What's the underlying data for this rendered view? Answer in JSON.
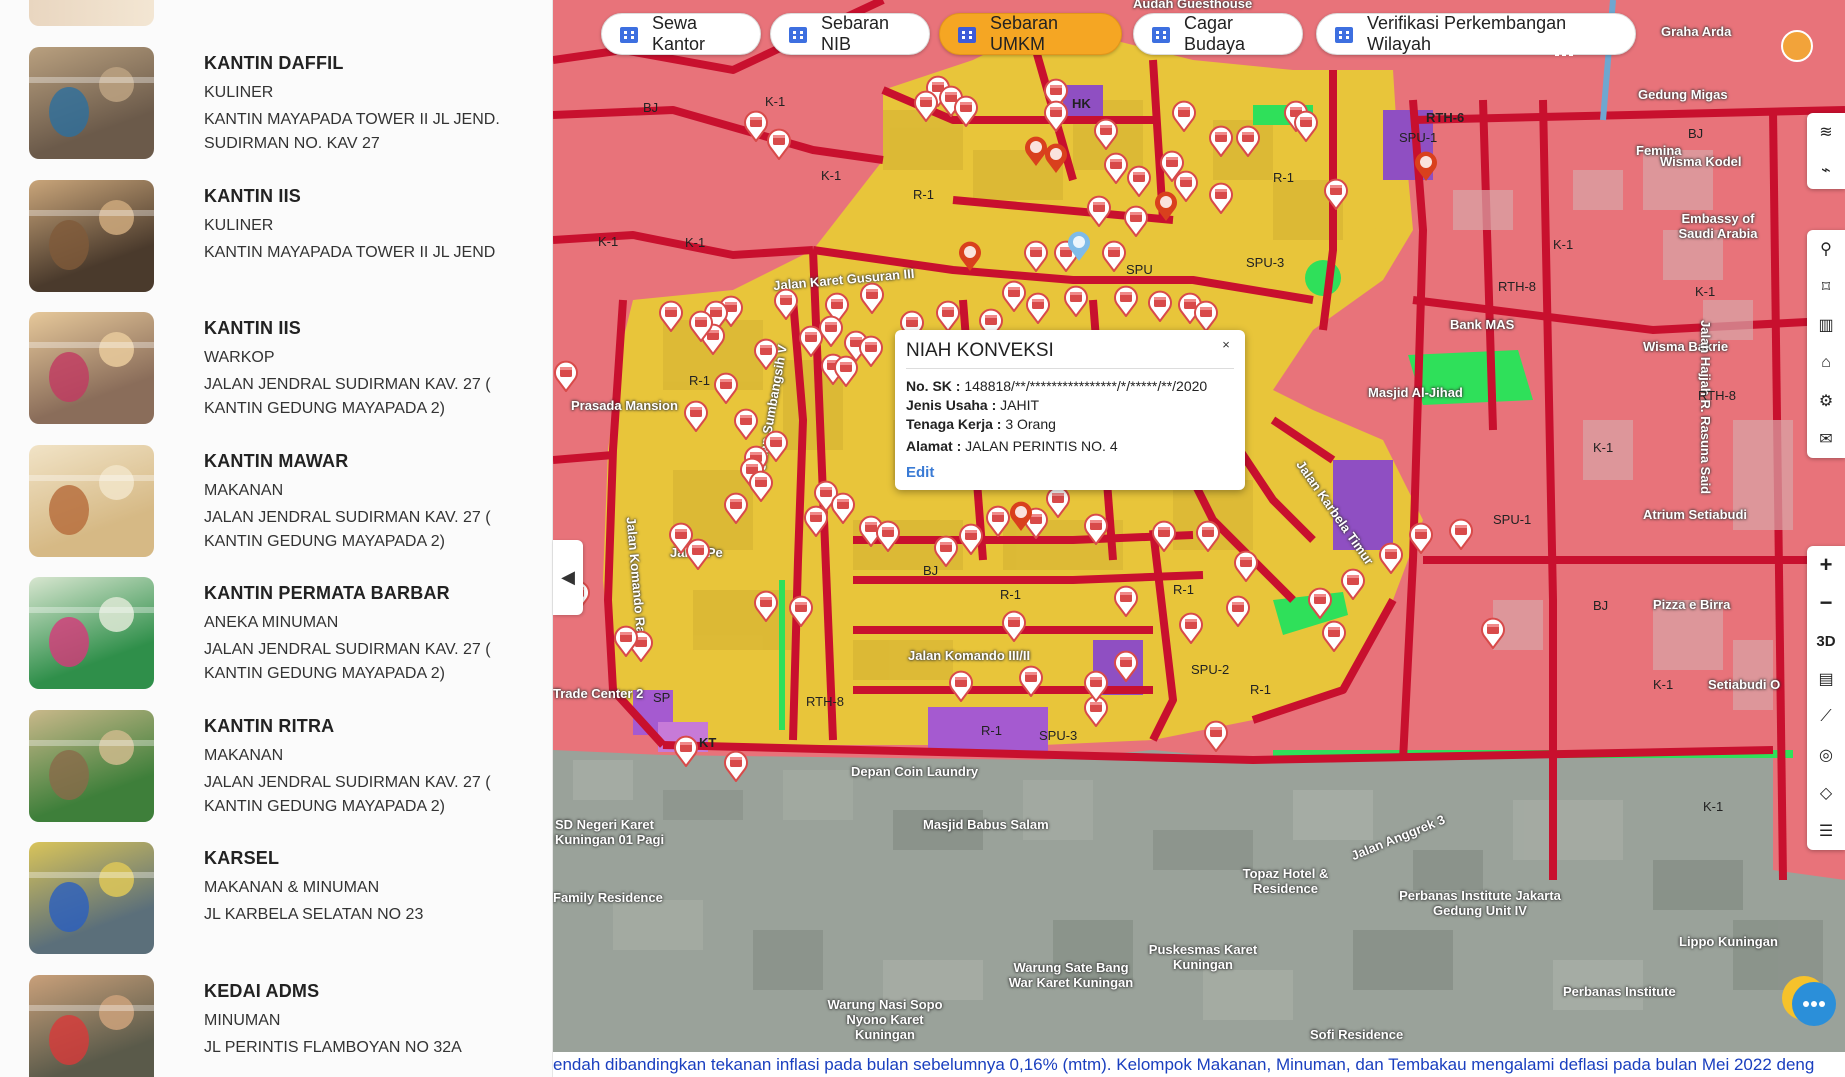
{
  "list": [
    {
      "title": "KANTIN DAFFIL",
      "category": "KULINER",
      "address": "KANTIN MAYAPADA TOWER II JL JEND. SUDIRMAN NO. KAV 27",
      "thumb_colors": [
        "#6b5a4a",
        "#b9a07f",
        "#2d6f9e"
      ]
    },
    {
      "title": "KANTIN IIS",
      "category": "KULINER",
      "address": "KANTIN MAYAPADA TOWER II JL JEND",
      "thumb_colors": [
        "#4a3a2c",
        "#c9a57a",
        "#7f5a3a"
      ]
    },
    {
      "title": "KANTIN IIS",
      "category": "WARKOP",
      "address": "JALAN JENDRAL SUDIRMAN KAV. 27 ( KANTIN GEDUNG MAYAPADA 2)",
      "thumb_colors": [
        "#8a6d5a",
        "#e6c89a",
        "#c23a62"
      ]
    },
    {
      "title": "KANTIN MAWAR",
      "category": "MAKANAN",
      "address": "JALAN JENDRAL SUDIRMAN KAV. 27 ( KANTIN GEDUNG MAYAPADA 2)",
      "thumb_colors": [
        "#d6b985",
        "#f1e3c6",
        "#b56a3a"
      ]
    },
    {
      "title": "KANTIN PERMATA BARBAR",
      "category": "ANEKA MINUMAN",
      "address": "JALAN JENDRAL SUDIRMAN KAV. 27 ( KANTIN GEDUNG MAYAPADA 2)",
      "thumb_colors": [
        "#2f8f4a",
        "#d8e6d0",
        "#d63a7a"
      ]
    },
    {
      "title": "KANTIN RITRA",
      "category": "MAKANAN",
      "address": "JALAN JENDRAL SUDIRMAN KAV. 27 ( KANTIN GEDUNG MAYAPADA 2)",
      "thumb_colors": [
        "#3e7f3a",
        "#c9b88a",
        "#8a6a4a"
      ]
    },
    {
      "title": "KARSEL",
      "category": "MAKANAN & MINUMAN",
      "address": "JL KARBELA SELATAN NO 23",
      "thumb_colors": [
        "#5b6f7a",
        "#d9c45a",
        "#2a5fbf"
      ]
    },
    {
      "title": "KEDAI ADMS",
      "category": "MINUMAN",
      "address": "JL PERINTIS FLAMBOYAN NO 32A",
      "thumb_colors": [
        "#5a5a4a",
        "#c9a07a",
        "#d83a3a"
      ]
    }
  ],
  "tabs": [
    {
      "label": "Sewa Kantor",
      "icon": "building-icon",
      "active": false
    },
    {
      "label": "Sebaran NIB",
      "icon": "home-icon",
      "active": false
    },
    {
      "label": "Sebaran UMKM",
      "icon": "store-icon",
      "active": true
    },
    {
      "label": "Cagar Budaya",
      "icon": "heritage-building-icon",
      "active": false
    },
    {
      "label": "Verifikasi Perkembangan Wilayah",
      "icon": "chart-search-icon",
      "active": false
    }
  ],
  "popup": {
    "title": "NIAH KONVEKSI",
    "no_sk_label": "No. SK :",
    "no_sk_value": "148818/**/****************/*/*****/**/2020",
    "jenis_label": "Jenis Usaha :",
    "jenis_value": "JAHIT",
    "tenaga_label": "Tenaga Kerja :",
    "tenaga_value": "3 Orang",
    "alamat_label": "Alamat :",
    "alamat_value": "JALAN PERINTIS NO. 4",
    "edit_label": "Edit",
    "close_label": "×"
  },
  "map": {
    "place_labels": [
      {
        "text": "Graha Arda"
      },
      {
        "text": "Gedung Migas"
      },
      {
        "text": "Femina"
      },
      {
        "text": "Wisma Kodel"
      },
      {
        "text": "Embassy of Saudi Arabia"
      },
      {
        "text": "Bank MAS"
      },
      {
        "text": "Masjid Al-Jihad"
      },
      {
        "text": "Wisma Bakrie"
      },
      {
        "text": "Atrium Setiabudi"
      },
      {
        "text": "Pizza e Birra"
      },
      {
        "text": "Setiabudi O"
      },
      {
        "text": "Prasada Mansion"
      },
      {
        "text": "Depan Coin Laundry"
      },
      {
        "text": "Masjid Babus Salam"
      },
      {
        "text": "SD Negeri Karet Kuningan 01 Pagi"
      },
      {
        "text": "Family Residence"
      },
      {
        "text": "Topaz Hotel & Residence"
      },
      {
        "text": "Perbanas Institute Jakarta Gedung Unit IV"
      },
      {
        "text": "Lippo Kuningan"
      },
      {
        "text": "Puskesmas Karet Kuningan"
      },
      {
        "text": "Warung Sate Bang War Karet Kuningan"
      },
      {
        "text": "Warung Nasi Sopo Nyono Karet Kuningan"
      },
      {
        "text": "Perbanas Institute"
      },
      {
        "text": "Sofi Residence"
      },
      {
        "text": "Trade Center 2"
      },
      {
        "text": "Audah Guesthouse"
      }
    ],
    "street_labels": [
      {
        "text": "Jalan Karet Gusuran III"
      },
      {
        "text": "Jalan Sumbangsih V"
      },
      {
        "text": "Jalan Komando Raya"
      },
      {
        "text": "Jalan Pe"
      },
      {
        "text": "Jalan Komando III/II"
      },
      {
        "text": "Jalan Karbela Timur"
      },
      {
        "text": "Jalan Anggrek 3"
      },
      {
        "text": "Jalan Hajjah R. Rasuna Said"
      }
    ],
    "zone_codes": [
      "K-1",
      "R-1",
      "BJ",
      "HK",
      "KT",
      "SPU-1",
      "SPU-2",
      "SPU-3",
      "RTH-6",
      "RTH-8",
      "SPU",
      "SP"
    ]
  },
  "map_controls_top": [
    {
      "icon": "layers-icon"
    },
    {
      "icon": "line-chart-icon"
    }
  ],
  "map_controls_mid": [
    {
      "icon": "pin-icon"
    },
    {
      "icon": "bookmark-icon"
    },
    {
      "icon": "buildings-icon"
    },
    {
      "icon": "house-icon"
    },
    {
      "icon": "bicycle-icon"
    },
    {
      "icon": "mail-icon"
    }
  ],
  "map_controls_bottom": [
    {
      "label": "+",
      "icon": "zoom-in-icon"
    },
    {
      "label": "−",
      "icon": "zoom-out-icon"
    },
    {
      "label": "3D",
      "icon": "3d-toggle-icon"
    },
    {
      "label": "",
      "icon": "print-icon"
    },
    {
      "label": "",
      "icon": "measure-line-icon"
    },
    {
      "label": "",
      "icon": "locate-icon"
    },
    {
      "label": "",
      "icon": "polygon-icon"
    },
    {
      "label": "",
      "icon": "basemap-icon"
    }
  ],
  "ticker": "endah dibandingkan tekanan inflasi pada bulan sebelumnya 0,16% (mtm). Kelompok Makanan, Minuman, dan Tembakau mengalami deflasi pada bulan Mei 2022 deng",
  "colors": {
    "zone_commercial": "#e8737a",
    "zone_residential": "#e8c53a",
    "zone_public": "#8f4fc2",
    "zone_green": "#2fe05a",
    "road": "#c8102e",
    "tab_active": "#f5a623",
    "ticker_text": "#1a3fbf"
  }
}
